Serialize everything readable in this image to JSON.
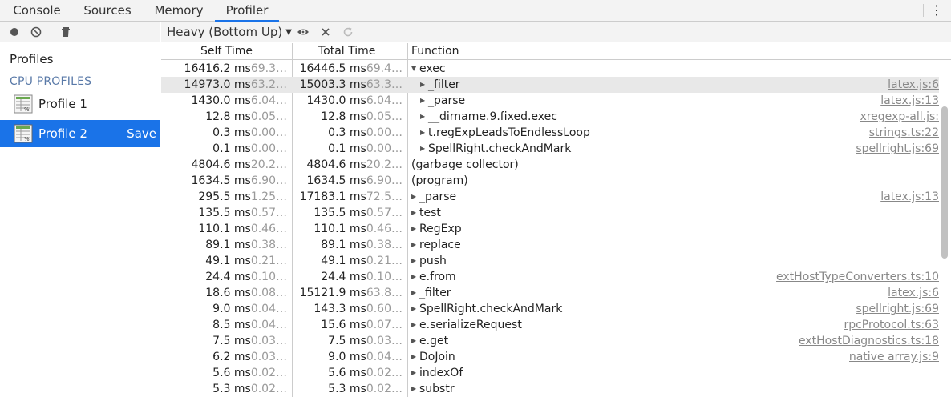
{
  "tabs": [
    {
      "label": "Console",
      "active": false
    },
    {
      "label": "Sources",
      "active": false
    },
    {
      "label": "Memory",
      "active": false
    },
    {
      "label": "Profiler",
      "active": true
    }
  ],
  "sidebar": {
    "heading": "Profiles",
    "section_label": "CPU PROFILES",
    "profiles": [
      {
        "label": "Profile 1",
        "selected": false
      },
      {
        "label": "Profile 2",
        "selected": true,
        "save_label": "Save"
      }
    ],
    "toolbar_icons": [
      "record-icon",
      "clear-icon",
      "trash-icon"
    ]
  },
  "toolbar": {
    "view_mode": "Heavy (Bottom Up)",
    "icons": [
      "eye-icon",
      "close-icon",
      "reload-icon"
    ]
  },
  "columns": {
    "self": "Self Time",
    "total": "Total Time",
    "function": "Function"
  },
  "rows": [
    {
      "self": "16416.2 ms",
      "self_pct": "69.3…",
      "total": "16446.5 ms",
      "total_pct": "69.4…",
      "fn": "exec",
      "toggle": "expanded",
      "depth": 0,
      "url": ""
    },
    {
      "self": "14973.0 ms",
      "self_pct": "63.2…",
      "total": "15003.3 ms",
      "total_pct": "63.3…",
      "fn": "_filter",
      "toggle": "collapsed",
      "depth": 1,
      "url": "latex.js:6",
      "highlight": true
    },
    {
      "self": "1430.0 ms",
      "self_pct": "6.04…",
      "total": "1430.0 ms",
      "total_pct": "6.04…",
      "fn": "_parse",
      "toggle": "collapsed",
      "depth": 1,
      "url": "latex.js:13"
    },
    {
      "self": "12.8 ms",
      "self_pct": "0.05…",
      "total": "12.8 ms",
      "total_pct": "0.05…",
      "fn": "__dirname.9.fixed.exec",
      "toggle": "collapsed",
      "depth": 1,
      "url": "xregexp-all.js:"
    },
    {
      "self": "0.3 ms",
      "self_pct": "0.00…",
      "total": "0.3 ms",
      "total_pct": "0.00…",
      "fn": "t.regExpLeadsToEndlessLoop",
      "toggle": "collapsed",
      "depth": 1,
      "url": "strings.ts:22"
    },
    {
      "self": "0.1 ms",
      "self_pct": "0.00…",
      "total": "0.1 ms",
      "total_pct": "0.00…",
      "fn": "SpellRight.checkAndMark",
      "toggle": "collapsed",
      "depth": 1,
      "url": "spellright.js:69"
    },
    {
      "self": "4804.6 ms",
      "self_pct": "20.2…",
      "total": "4804.6 ms",
      "total_pct": "20.2…",
      "fn": "(garbage collector)",
      "toggle": "none",
      "depth": 0,
      "url": ""
    },
    {
      "self": "1634.5 ms",
      "self_pct": "6.90…",
      "total": "1634.5 ms",
      "total_pct": "6.90…",
      "fn": "(program)",
      "toggle": "none",
      "depth": 0,
      "url": ""
    },
    {
      "self": "295.5 ms",
      "self_pct": "1.25…",
      "total": "17183.1 ms",
      "total_pct": "72.5…",
      "fn": "_parse",
      "toggle": "collapsed",
      "depth": 0,
      "url": "latex.js:13"
    },
    {
      "self": "135.5 ms",
      "self_pct": "0.57…",
      "total": "135.5 ms",
      "total_pct": "0.57…",
      "fn": "test",
      "toggle": "collapsed",
      "depth": 0,
      "url": ""
    },
    {
      "self": "110.1 ms",
      "self_pct": "0.46…",
      "total": "110.1 ms",
      "total_pct": "0.46…",
      "fn": "RegExp",
      "toggle": "collapsed",
      "depth": 0,
      "url": ""
    },
    {
      "self": "89.1 ms",
      "self_pct": "0.38…",
      "total": "89.1 ms",
      "total_pct": "0.38…",
      "fn": "replace",
      "toggle": "collapsed",
      "depth": 0,
      "url": ""
    },
    {
      "self": "49.1 ms",
      "self_pct": "0.21…",
      "total": "49.1 ms",
      "total_pct": "0.21…",
      "fn": "push",
      "toggle": "collapsed",
      "depth": 0,
      "url": ""
    },
    {
      "self": "24.4 ms",
      "self_pct": "0.10…",
      "total": "24.4 ms",
      "total_pct": "0.10…",
      "fn": "e.from",
      "toggle": "collapsed",
      "depth": 0,
      "url": "extHostTypeConverters.ts:10"
    },
    {
      "self": "18.6 ms",
      "self_pct": "0.08…",
      "total": "15121.9 ms",
      "total_pct": "63.8…",
      "fn": "_filter",
      "toggle": "collapsed",
      "depth": 0,
      "url": "latex.js:6"
    },
    {
      "self": "9.0 ms",
      "self_pct": "0.04…",
      "total": "143.3 ms",
      "total_pct": "0.60…",
      "fn": "SpellRight.checkAndMark",
      "toggle": "collapsed",
      "depth": 0,
      "url": "spellright.js:69"
    },
    {
      "self": "8.5 ms",
      "self_pct": "0.04…",
      "total": "15.6 ms",
      "total_pct": "0.07…",
      "fn": "e.serializeRequest",
      "toggle": "collapsed",
      "depth": 0,
      "url": "rpcProtocol.ts:63"
    },
    {
      "self": "7.5 ms",
      "self_pct": "0.03…",
      "total": "7.5 ms",
      "total_pct": "0.03…",
      "fn": "e.get",
      "toggle": "collapsed",
      "depth": 0,
      "url": "extHostDiagnostics.ts:18"
    },
    {
      "self": "6.2 ms",
      "self_pct": "0.03…",
      "total": "9.0 ms",
      "total_pct": "0.04…",
      "fn": "DoJoin",
      "toggle": "collapsed",
      "depth": 0,
      "url": "native array.js:9"
    },
    {
      "self": "5.6 ms",
      "self_pct": "0.02…",
      "total": "5.6 ms",
      "total_pct": "0.02…",
      "fn": "indexOf",
      "toggle": "collapsed",
      "depth": 0,
      "url": ""
    },
    {
      "self": "5.3 ms",
      "self_pct": "0.02…",
      "total": "5.3 ms",
      "total_pct": "0.02…",
      "fn": "substr",
      "toggle": "collapsed",
      "depth": 0,
      "url": ""
    }
  ],
  "colors": {
    "accent": "#1a73e8",
    "selected_row": "#e8e8e8",
    "section_label": "#5a7aa8"
  }
}
